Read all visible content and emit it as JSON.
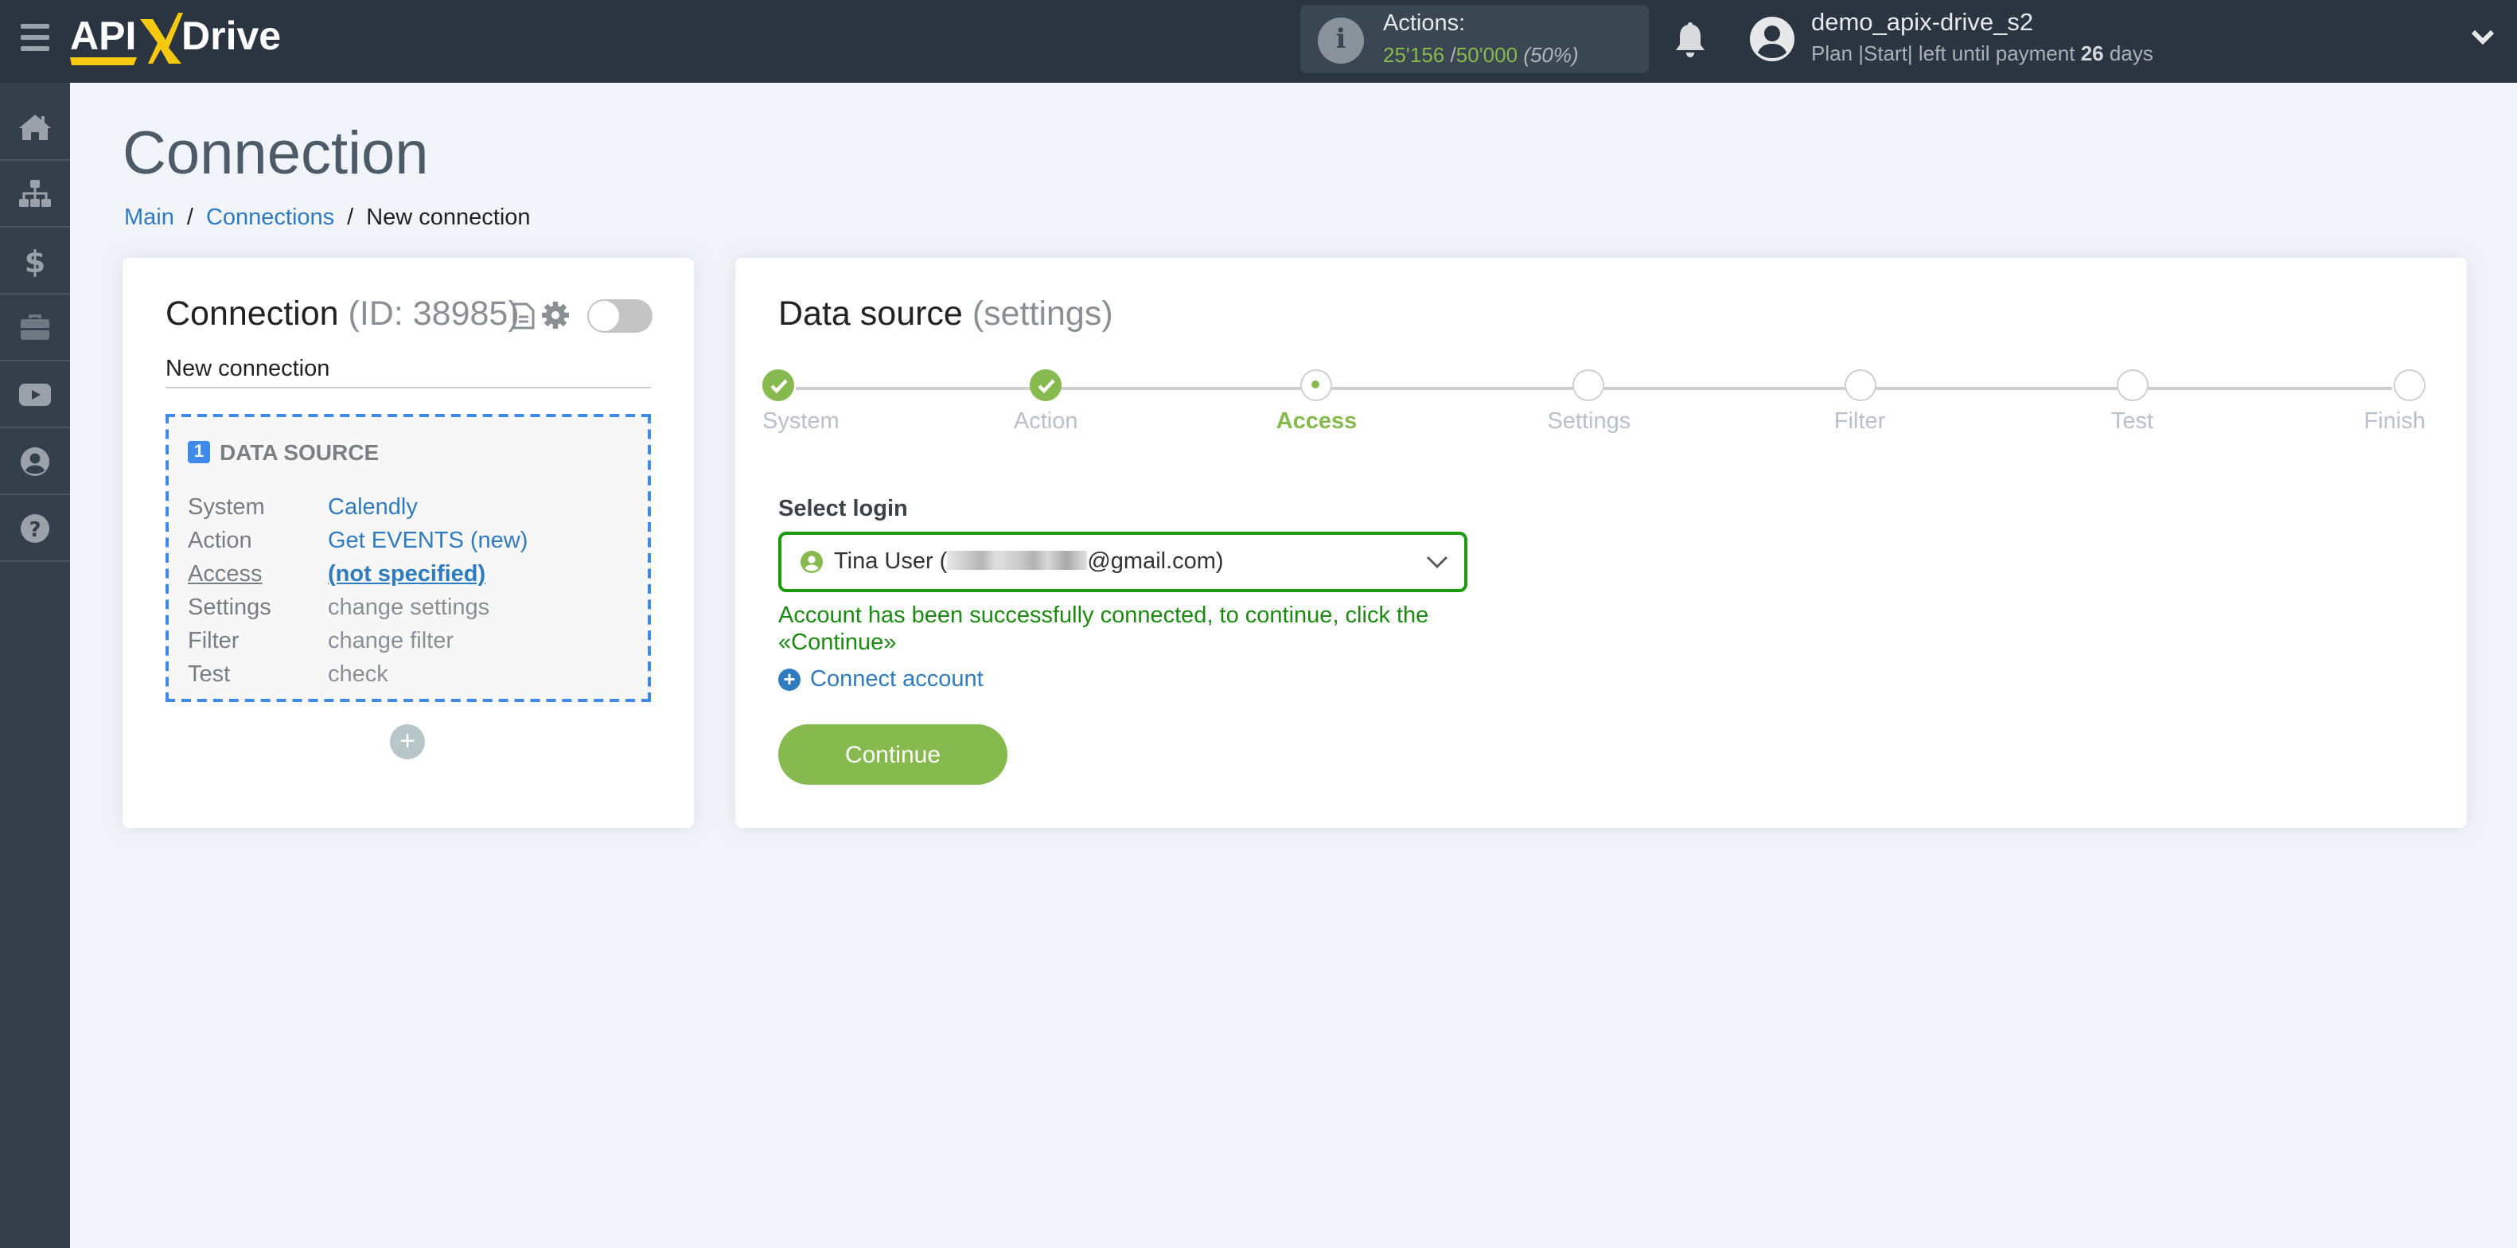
{
  "header": {
    "logo_text": "APIXDrive",
    "actions": {
      "label": "Actions:",
      "used": "25'156",
      "separator": "/",
      "total": "50'000",
      "percent": "(50%)"
    },
    "user": {
      "name": "demo_apix-drive_s2",
      "plan_prefix": "Plan |Start| left until payment",
      "days_left": "26",
      "days_suffix": "days"
    }
  },
  "sidebar": {
    "items": [
      {
        "icon": "home-icon",
        "label": "Home"
      },
      {
        "icon": "sitemap-icon",
        "label": "Connections"
      },
      {
        "icon": "dollar-icon",
        "label": "Billing"
      },
      {
        "icon": "briefcase-icon",
        "label": "Services"
      },
      {
        "icon": "youtube-icon",
        "label": "Video"
      },
      {
        "icon": "user-circle-icon",
        "label": "Profile"
      },
      {
        "icon": "question-icon",
        "label": "Help"
      }
    ]
  },
  "page": {
    "title": "Connection",
    "breadcrumb": [
      {
        "label": "Main",
        "link": true
      },
      {
        "label": "Connections",
        "link": true
      },
      {
        "label": "New connection",
        "link": false
      }
    ]
  },
  "connection_panel": {
    "title": "Connection",
    "id_text": "(ID: 38985)",
    "name_value": "New connection",
    "toggle_on": false,
    "data_source": {
      "number": "1",
      "title": "DATA SOURCE",
      "rows": [
        {
          "key": "System",
          "value": "Calendly"
        },
        {
          "key": "Action",
          "value": "Get EVENTS (new)"
        },
        {
          "key": "Access",
          "value": "(not specified)"
        },
        {
          "key": "Settings",
          "value": "change settings"
        },
        {
          "key": "Filter",
          "value": "change filter"
        },
        {
          "key": "Test",
          "value": "check"
        }
      ]
    },
    "add_button": "+"
  },
  "settings_panel": {
    "title": "Data source",
    "title_suffix": "(settings)",
    "steps": [
      {
        "label": "System",
        "state": "done"
      },
      {
        "label": "Action",
        "state": "done"
      },
      {
        "label": "Access",
        "state": "current"
      },
      {
        "label": "Settings",
        "state": "pending"
      },
      {
        "label": "Filter",
        "state": "pending"
      },
      {
        "label": "Test",
        "state": "pending"
      },
      {
        "label": "Finish",
        "state": "pending"
      }
    ],
    "select_label": "Select login",
    "selected_login_prefix": "Tina User (",
    "selected_login_suffix": "@gmail.com)",
    "success_message": "Account has been successfully connected, to continue, click the «Continue»",
    "connect_account": "Connect account",
    "continue_button": "Continue"
  },
  "colors": {
    "header_bg": "#2b3542",
    "sidebar_bg": "#353f4c",
    "accent_green": "#86ba4e",
    "link_blue": "#2f7bbf",
    "success_green": "#1a8a10",
    "logo_yellow": "#f5c90f"
  }
}
